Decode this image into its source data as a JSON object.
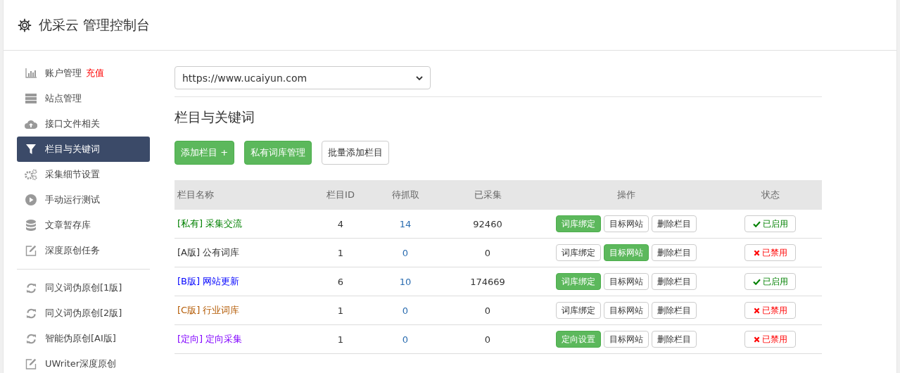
{
  "header": {
    "title": "优采云 管理控制台"
  },
  "sidebar": {
    "groups": [
      {
        "items": [
          {
            "kind": "chart",
            "label": "账户管理",
            "badge": "充值",
            "selected": false
          },
          {
            "kind": "server",
            "label": "站点管理",
            "selected": false
          },
          {
            "kind": "cloud",
            "label": "接口文件相关",
            "selected": false
          },
          {
            "kind": "filter",
            "label": "栏目与关键词",
            "selected": true
          },
          {
            "kind": "gears",
            "label": "采集细节设置",
            "selected": false
          },
          {
            "kind": "play",
            "label": "手动运行测试",
            "selected": false
          },
          {
            "kind": "database",
            "label": "文章暂存库",
            "selected": false
          },
          {
            "kind": "edit",
            "label": "深度原创任务",
            "selected": false
          }
        ]
      },
      {
        "items": [
          {
            "kind": "refresh",
            "label": "同义词伪原创[1版]",
            "selected": false
          },
          {
            "kind": "refresh",
            "label": "同义词伪原创[2版]",
            "selected": false
          },
          {
            "kind": "refresh",
            "label": "智能伪原创[AI版]",
            "selected": false
          },
          {
            "kind": "edit",
            "label": "UWriter深度原创",
            "selected": false
          }
        ]
      }
    ]
  },
  "site_select": {
    "value": "https://www.ucaiyun.com"
  },
  "section_title": "栏目与关键词",
  "toolbar": [
    {
      "label": "添加栏目 +",
      "primary": true
    },
    {
      "label": "私有词库管理",
      "primary": true
    },
    {
      "label": "批量添加栏目",
      "primary": false
    }
  ],
  "table": {
    "columns": [
      "栏目名称",
      "栏目ID",
      "待抓取",
      "已采集",
      "操作",
      "状态"
    ],
    "rows": [
      {
        "tag": "[私有]",
        "name": "采集交流",
        "color": "#008000",
        "id": "4",
        "pending": "14",
        "collected": "92460",
        "actions": [
          {
            "label": "词库绑定",
            "selected": true
          },
          {
            "label": "目标网站",
            "selected": false
          },
          {
            "label": "删除栏目",
            "selected": false
          }
        ],
        "status": {
          "label": "已启用",
          "enabled": true
        }
      },
      {
        "tag": "[A版]",
        "name": "公有词库",
        "color": "#333333",
        "id": "1",
        "pending": "0",
        "collected": "0",
        "actions": [
          {
            "label": "词库绑定",
            "selected": false
          },
          {
            "label": "目标网站",
            "selected": true
          },
          {
            "label": "删除栏目",
            "selected": false
          }
        ],
        "status": {
          "label": "已禁用",
          "enabled": false
        }
      },
      {
        "tag": "[B版]",
        "name": "网站更新",
        "color": "#0000ff",
        "id": "6",
        "pending": "10",
        "collected": "174669",
        "actions": [
          {
            "label": "词库绑定",
            "selected": true
          },
          {
            "label": "目标网站",
            "selected": false
          },
          {
            "label": "删除栏目",
            "selected": false
          }
        ],
        "status": {
          "label": "已启用",
          "enabled": true
        }
      },
      {
        "tag": "[C版]",
        "name": "行业词库",
        "color": "#b35900",
        "id": "1",
        "pending": "0",
        "collected": "0",
        "actions": [
          {
            "label": "词库绑定",
            "selected": false
          },
          {
            "label": "目标网站",
            "selected": false
          },
          {
            "label": "删除栏目",
            "selected": false
          }
        ],
        "status": {
          "label": "已禁用",
          "enabled": false
        }
      },
      {
        "tag": "[定向]",
        "name": "定向采集",
        "color": "#8000ff",
        "id": "1",
        "pending": "0",
        "collected": "0",
        "actions": [
          {
            "label": "定向设置",
            "selected": true
          },
          {
            "label": "目标网站",
            "selected": false
          },
          {
            "label": "删除栏目",
            "selected": false
          }
        ],
        "status": {
          "label": "已禁用",
          "enabled": false
        }
      }
    ]
  }
}
